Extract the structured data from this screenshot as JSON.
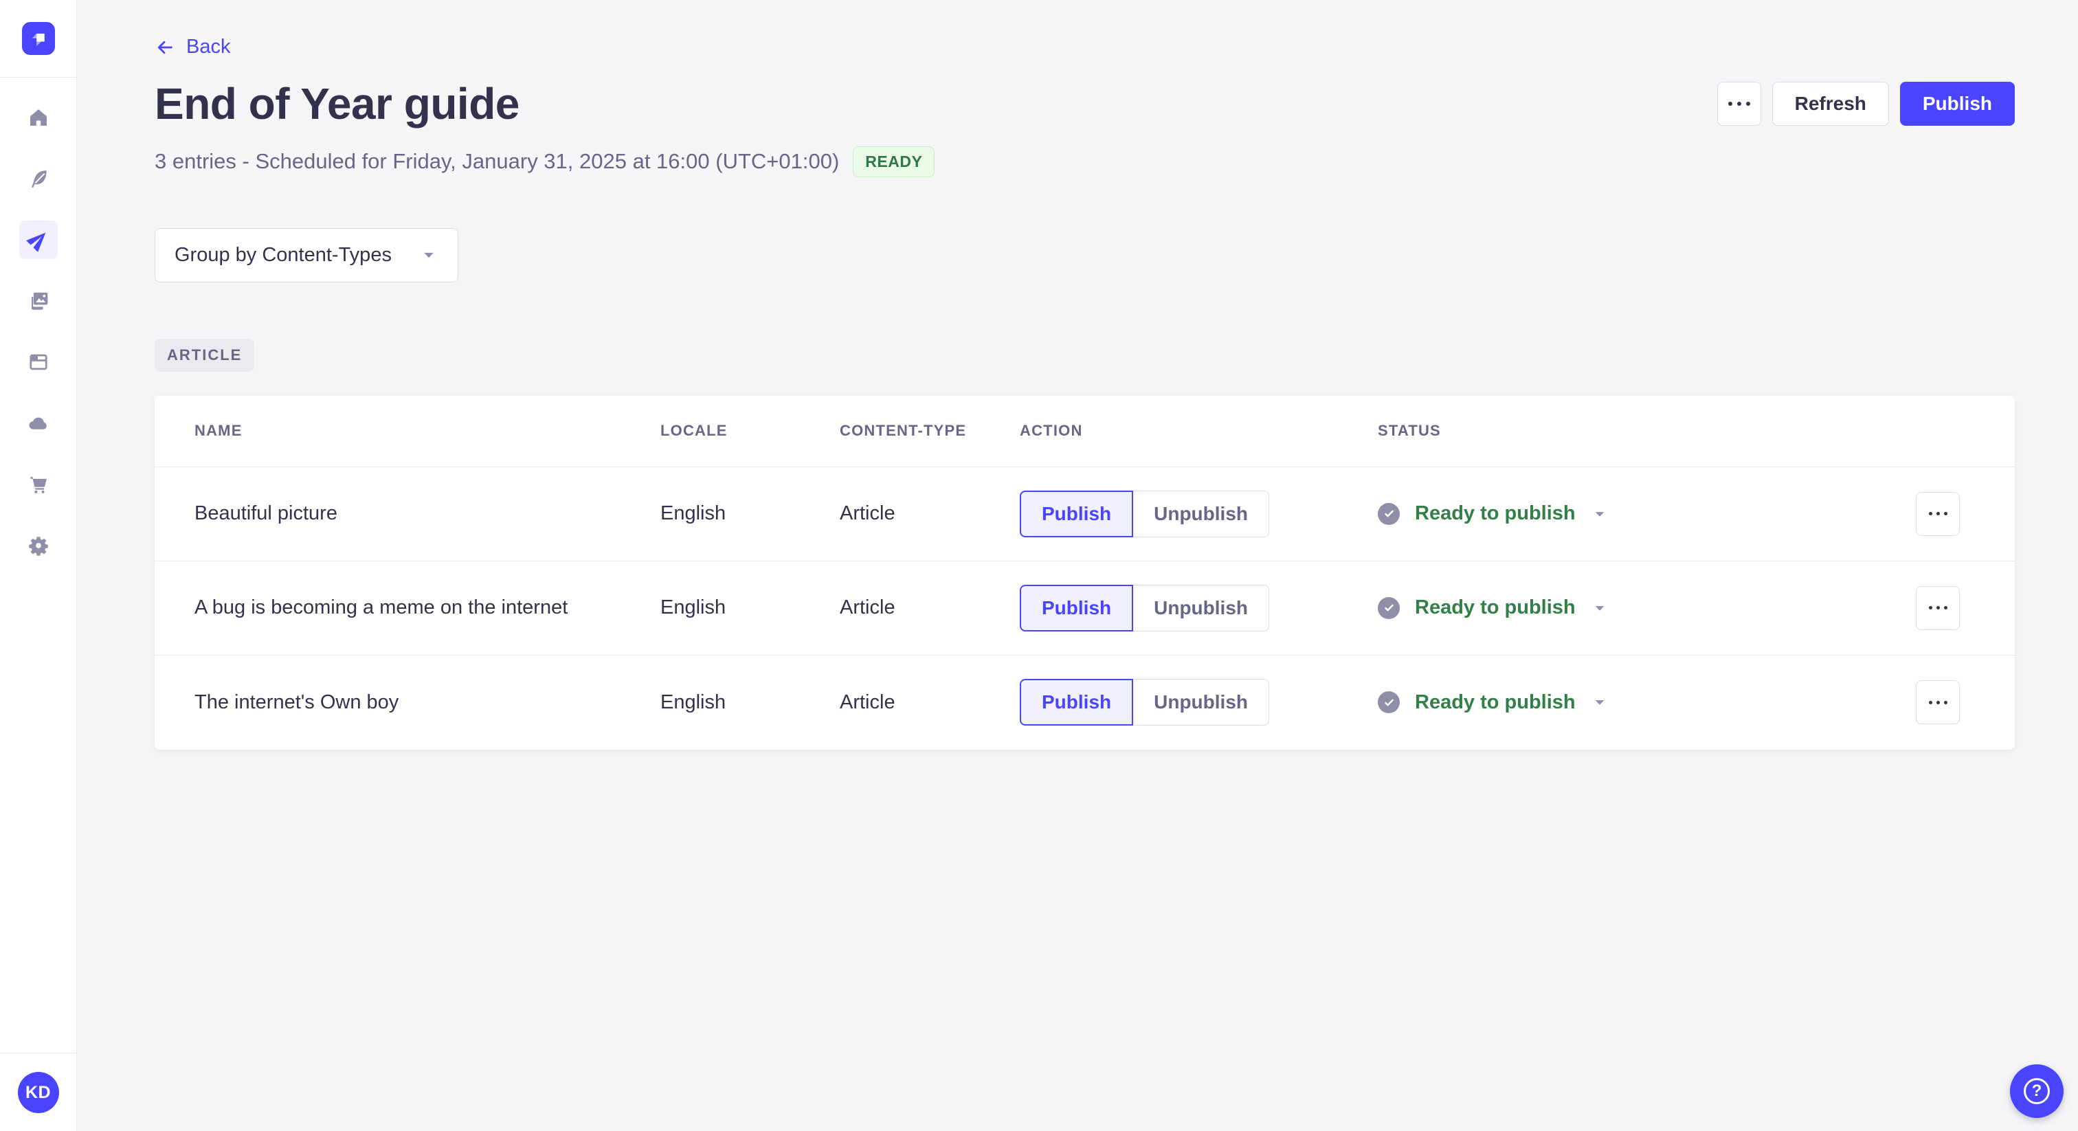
{
  "colors": {
    "accent": "#4945ff",
    "accent_bg": "#f0f0ff",
    "page_bg": "#f6f6f9",
    "border": "#dcdce4",
    "divider": "#eaeaef",
    "text_dark": "#32324d",
    "text_muted": "#666687",
    "icon_gray": "#8e8ea9",
    "success_badge_text": "#2f7846",
    "success_badge_bg": "#eafbe7",
    "success_badge_border": "#c6f0c2",
    "status_green": "#328048"
  },
  "sidebar": {
    "logo_icon": "strapi-logo",
    "items": [
      {
        "icon": "home-icon",
        "active": false
      },
      {
        "icon": "feather-icon",
        "active": false
      },
      {
        "icon": "paper-plane-icon",
        "active": true
      },
      {
        "icon": "media-library-icon",
        "active": false
      },
      {
        "icon": "layout-icon",
        "active": false
      },
      {
        "icon": "cloud-icon",
        "active": false
      },
      {
        "icon": "cart-icon",
        "active": false
      },
      {
        "icon": "gear-icon",
        "active": false
      }
    ],
    "avatar_initials": "KD"
  },
  "header": {
    "back_label": "Back",
    "title": "End of Year guide",
    "subtitle": "3 entries - Scheduled for Friday, January 31, 2025 at 16:00 (UTC+01:00)",
    "status_badge": "READY",
    "more_icon": "ellipsis-icon",
    "refresh_label": "Refresh",
    "publish_label": "Publish"
  },
  "toolbar": {
    "group_by_label": "Group by Content-Types",
    "caret_icon": "chevron-down-icon"
  },
  "group": {
    "badge": "ARTICLE"
  },
  "table": {
    "columns": [
      "NAME",
      "LOCALE",
      "CONTENT-TYPE",
      "ACTION",
      "STATUS"
    ],
    "rows": [
      {
        "name": "Beautiful picture",
        "locale": "English",
        "content_type": "Article",
        "publish_label": "Publish",
        "unpublish_label": "Unpublish",
        "selected_action": "Publish",
        "status": "Ready to publish",
        "status_icon": "check-circle-icon"
      },
      {
        "name": "A bug is becoming a meme on the internet",
        "locale": "English",
        "content_type": "Article",
        "publish_label": "Publish",
        "unpublish_label": "Unpublish",
        "selected_action": "Publish",
        "status": "Ready to publish",
        "status_icon": "check-circle-icon"
      },
      {
        "name": "The internet's Own boy",
        "locale": "English",
        "content_type": "Article",
        "publish_label": "Publish",
        "unpublish_label": "Unpublish",
        "selected_action": "Publish",
        "status": "Ready to publish",
        "status_icon": "check-circle-icon"
      }
    ]
  },
  "help": {
    "icon": "question-icon",
    "glyph": "?"
  }
}
